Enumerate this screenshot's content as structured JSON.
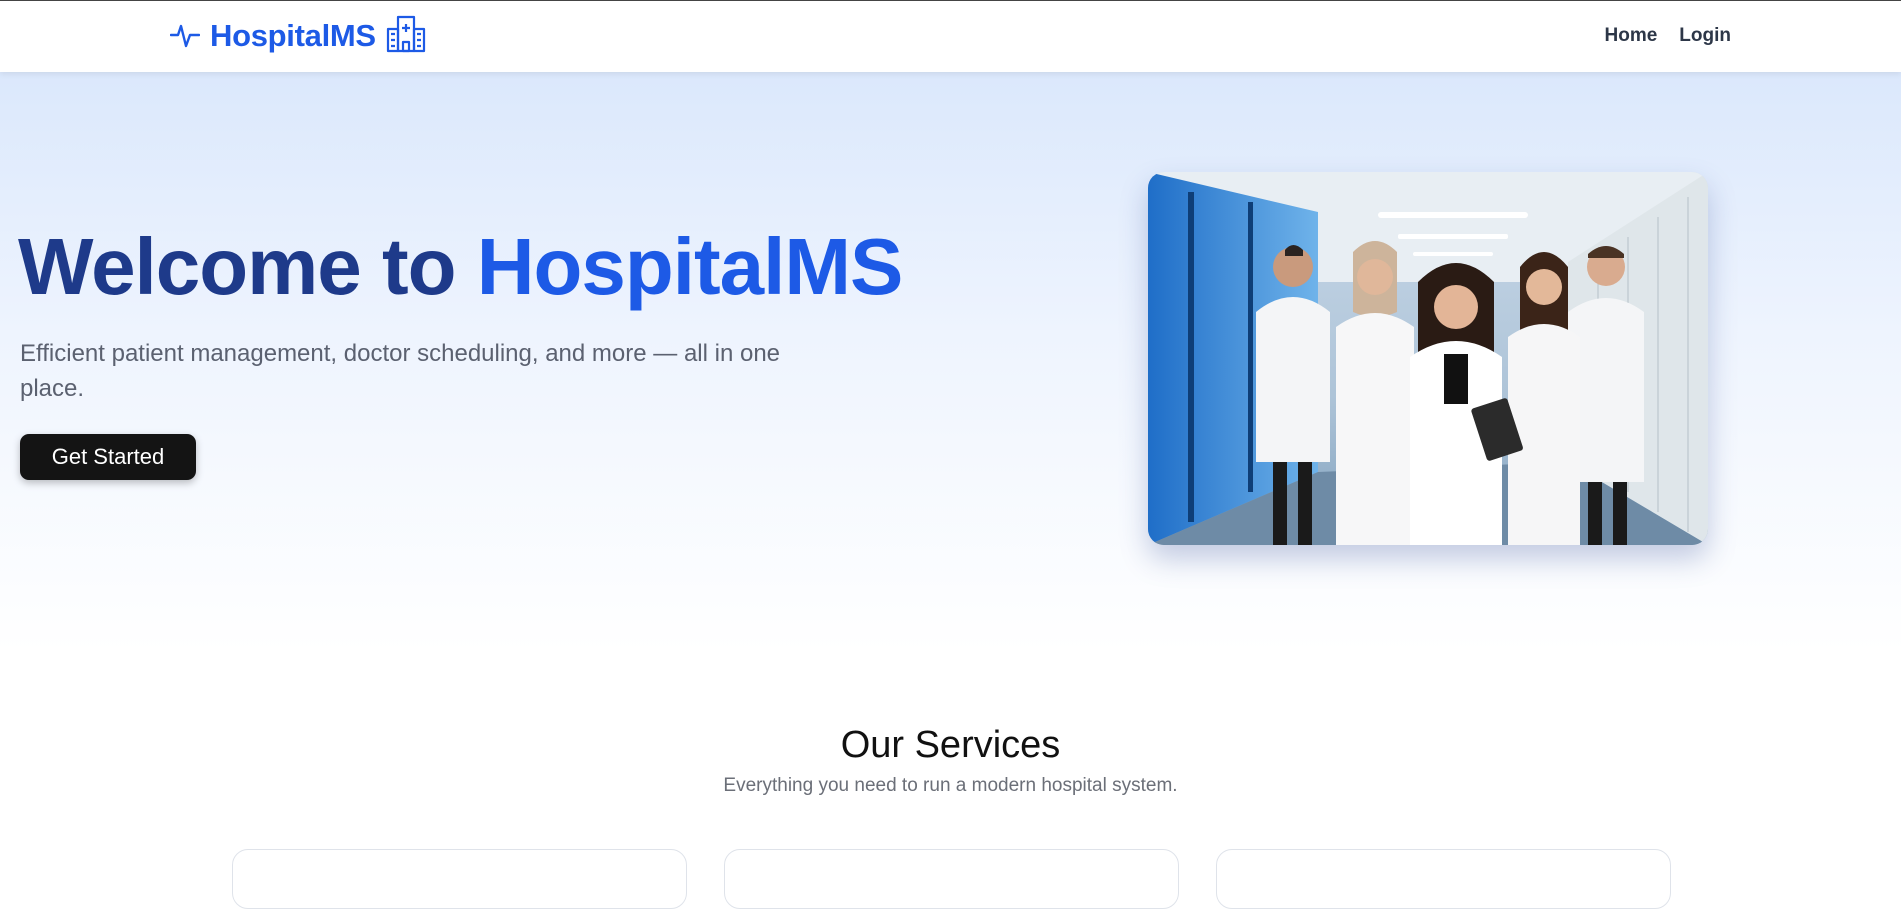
{
  "brand": {
    "name": "HospitalMS",
    "left_icon": "heartbeat-icon",
    "right_icon": "hospital-building-icon",
    "color": "#1d5ae6"
  },
  "nav": {
    "links": [
      "Home",
      "Login"
    ]
  },
  "hero": {
    "title_part1": "Welcome to",
    "title_part2": "HospitalMS",
    "subtitle": "Efficient patient management, doctor scheduling, and more — all in one place.",
    "cta_label": "Get Started",
    "image": "group-of-doctors-photo",
    "colors": {
      "title_dark": "#1e3a8a",
      "title_accent": "#1d5ae6",
      "cta_bg": "#141414"
    }
  },
  "services": {
    "title": "Our Services",
    "subtitle": "Everything you need to run a modern hospital system."
  }
}
